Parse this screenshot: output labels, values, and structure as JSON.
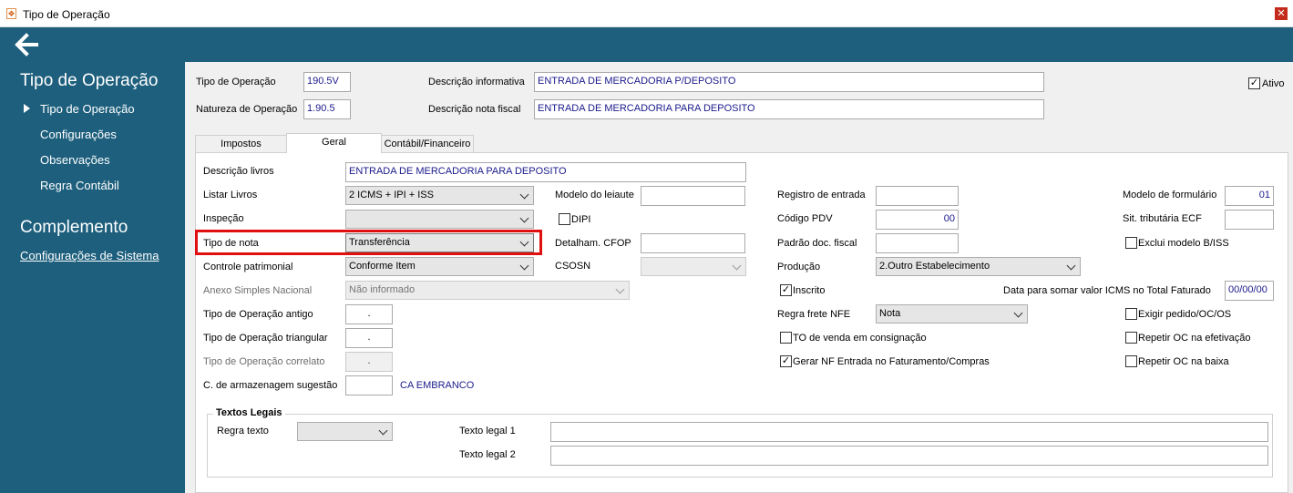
{
  "window": {
    "title": "Tipo de Operação",
    "app_icon": "app-logo-icon"
  },
  "sidebar": {
    "section1_title": "Tipo de Operação",
    "items": [
      {
        "label": "Tipo de Operação",
        "selected": true
      },
      {
        "label": "Configurações"
      },
      {
        "label": "Observações"
      },
      {
        "label": "Regra Contábil"
      }
    ],
    "section2_title": "Complemento",
    "link": "Configurações de Sistema"
  },
  "colors": {
    "header": "#1d5f7d",
    "highlight_box": "#e01010"
  },
  "header": {
    "tipo_operacao_label": "Tipo de Operação",
    "tipo_operacao_value": "190.5V",
    "natureza_label": "Natureza de Operação",
    "natureza_value": "1.90.5",
    "desc_informativa_label": "Descrição informativa",
    "desc_informativa_value": "ENTRADA DE MERCADORIA P/DEPOSITO",
    "desc_nota_label": "Descrição nota fiscal",
    "desc_nota_value": "ENTRADA DE MERCADORIA PARA DEPOSITO",
    "ativo_label": "Ativo",
    "ativo_checked": true
  },
  "tabs": [
    {
      "label": "Impostos"
    },
    {
      "label": "Geral",
      "active": true
    },
    {
      "label": "Contábil/Financeiro"
    }
  ],
  "geral": {
    "descricao_livros_label": "Descrição livros",
    "descricao_livros_value": "ENTRADA DE MERCADORIA PARA DEPOSITO",
    "listar_livros_label": "Listar Livros",
    "listar_livros_value": "2 ICMS + IPI + ISS",
    "inspecao_label": "Inspeção",
    "inspecao_value": "",
    "tipo_nota_label": "Tipo de nota",
    "tipo_nota_value": "Transferência",
    "controle_label": "Controle patrimonial",
    "controle_value": "Conforme Item",
    "anexo_label": "Anexo Simples Nacional",
    "anexo_value": "Não informado",
    "to_antigo_label": "Tipo de Operação antigo",
    "to_antigo_value": ".",
    "to_triangular_label": "Tipo de Operação triangular",
    "to_triangular_value": ".",
    "to_correlato_label": "Tipo de Operação correlato",
    "to_correlato_value": ".",
    "armazenagem_label": "C. de armazenagem sugestão",
    "armazenagem_value": "",
    "armazenagem_desc": "CA EMBRANCO",
    "modelo_leiaute_label": "Modelo do leiaute",
    "dipi_label": "DIPI",
    "detalham_label": "Detalham. CFOP",
    "csosn_label": "CSOSN",
    "registro_entrada_label": "Registro de entrada",
    "codigo_pdv_label": "Código PDV",
    "codigo_pdv_value": "00",
    "padrao_doc_label": "Padrão doc. fiscal",
    "producao_label": "Produção",
    "producao_value": "2.Outro Estabelecimento",
    "inscrito_label": "Inscrito",
    "data_somar_label": "Data para somar valor ICMS no Total Faturado",
    "data_somar_value": "00/00/00",
    "regra_frete_label": "Regra frete NFE",
    "regra_frete_value": "Nota",
    "to_venda_label": "TO de venda em consignação",
    "gerar_nf_label": "Gerar NF Entrada no Faturamento/Compras",
    "modelo_formulario_label": "Modelo de formulário",
    "modelo_formulario_value": "01",
    "sit_tributaria_label": "Sit. tributária ECF",
    "exclui_modelo_label": "Exclui modelo B/ISS",
    "exigir_pedido_label": "Exigir pedido/OC/OS",
    "repetir_efetivacao_label": "Repetir OC na efetivação",
    "repetir_baixa_label": "Repetir OC na baixa"
  },
  "textos_legais": {
    "title": "Textos Legais",
    "regra_texto_label": "Regra texto",
    "texto_legal_1_label": "Texto legal 1",
    "texto_legal_2_label": "Texto legal 2"
  }
}
